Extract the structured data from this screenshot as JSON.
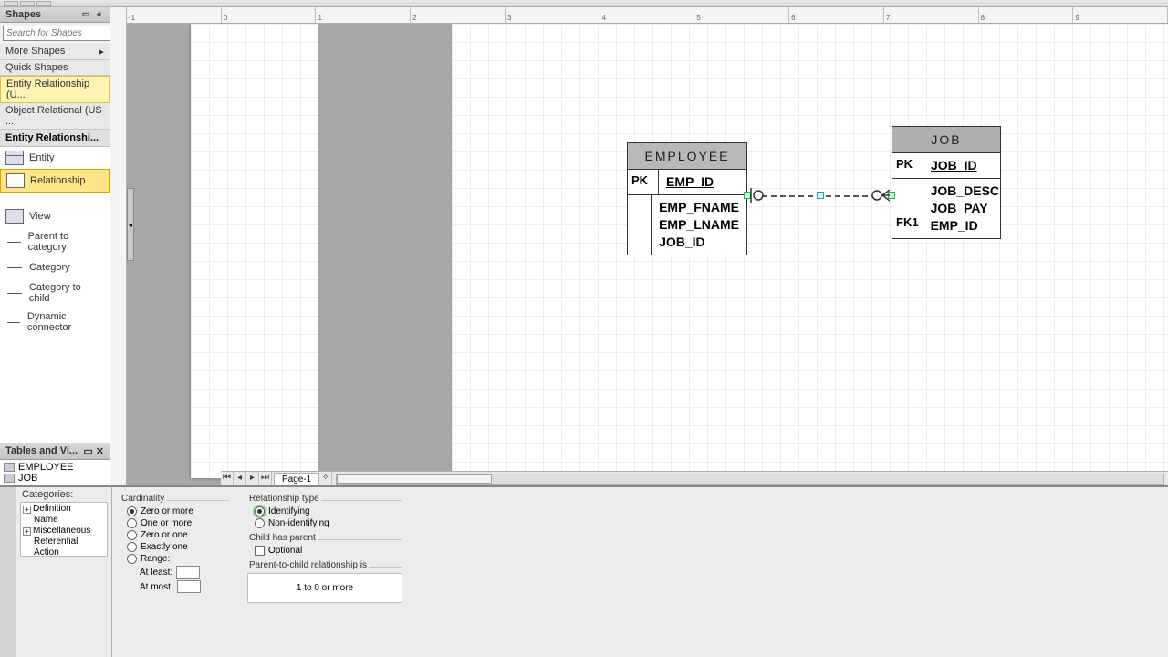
{
  "shapes_pane": {
    "title": "Shapes",
    "search_placeholder": "Search for Shapes",
    "more_shapes": "More Shapes",
    "quick_shapes": "Quick Shapes",
    "stencils": [
      "Entity Relationship (U...",
      "Object Relational (US ..."
    ],
    "stencil_title": "Entity Relationshi...",
    "items": [
      "Entity",
      "Relationship",
      "View",
      "Parent to category",
      "Category",
      "Category to child",
      "Dynamic connector"
    ]
  },
  "tables_pane": {
    "title": "Tables and Vi...",
    "items": [
      "EMPLOYEE",
      "JOB"
    ]
  },
  "page_tab": "Page-1",
  "ruler_ticks": [
    "-1",
    "0",
    "1",
    "2",
    "3",
    "4",
    "5",
    "6",
    "7",
    "8",
    "9"
  ],
  "entities": {
    "employee": {
      "title": "EMPLOYEE",
      "pk_label": "PK",
      "pk": "EMP_ID",
      "attrs": [
        "EMP_FNAME",
        "EMP_LNAME",
        "JOB_ID"
      ]
    },
    "job": {
      "title": "JOB",
      "pk_label": "PK",
      "pk": "JOB_ID",
      "fk_label": "FK1",
      "attrs": [
        "JOB_DESC",
        "JOB_PAY",
        "EMP_ID"
      ]
    }
  },
  "props": {
    "categories_hdr": "Categories:",
    "cats": [
      "Definition",
      "Name",
      "Miscellaneous",
      "Referential Action"
    ],
    "cardinality": {
      "title": "Cardinality",
      "opts": [
        "Zero or more",
        "One or more",
        "Zero or one",
        "Exactly one",
        "Range:"
      ],
      "at_least": "At least:",
      "at_most": "At most:"
    },
    "rel_type": {
      "title": "Relationship type",
      "opts": [
        "Identifying",
        "Non-identifying"
      ]
    },
    "child_parent": {
      "title": "Child has parent",
      "optional": "Optional"
    },
    "parent_child": {
      "title": "Parent-to-child relationship is",
      "text": "1  to  0 or more"
    }
  }
}
